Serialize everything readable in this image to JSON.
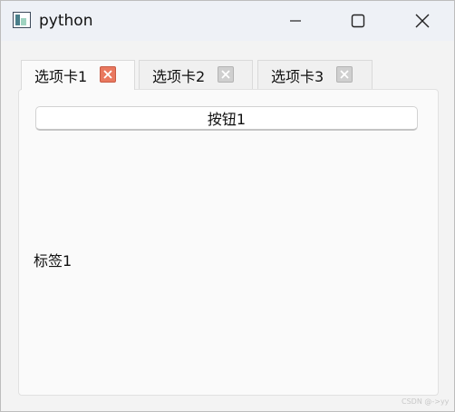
{
  "window": {
    "title": "python",
    "icon": "python-app-icon",
    "controls": {
      "minimize_icon": "minimize-icon",
      "maximize_icon": "maximize-icon",
      "close_icon": "close-icon"
    }
  },
  "tabs": [
    {
      "label": "选项卡1",
      "active": true,
      "close_icon": "tab-close-icon",
      "close_color": "#e9785f"
    },
    {
      "label": "选项卡2",
      "active": false,
      "close_icon": "tab-close-icon",
      "close_color": "#cfcfcf"
    },
    {
      "label": "选项卡3",
      "active": false,
      "close_icon": "tab-close-icon",
      "close_color": "#cfcfcf"
    }
  ],
  "content": {
    "button_label": "按钮1",
    "label_text": "标签1"
  },
  "watermark": "CSDN @->yy"
}
